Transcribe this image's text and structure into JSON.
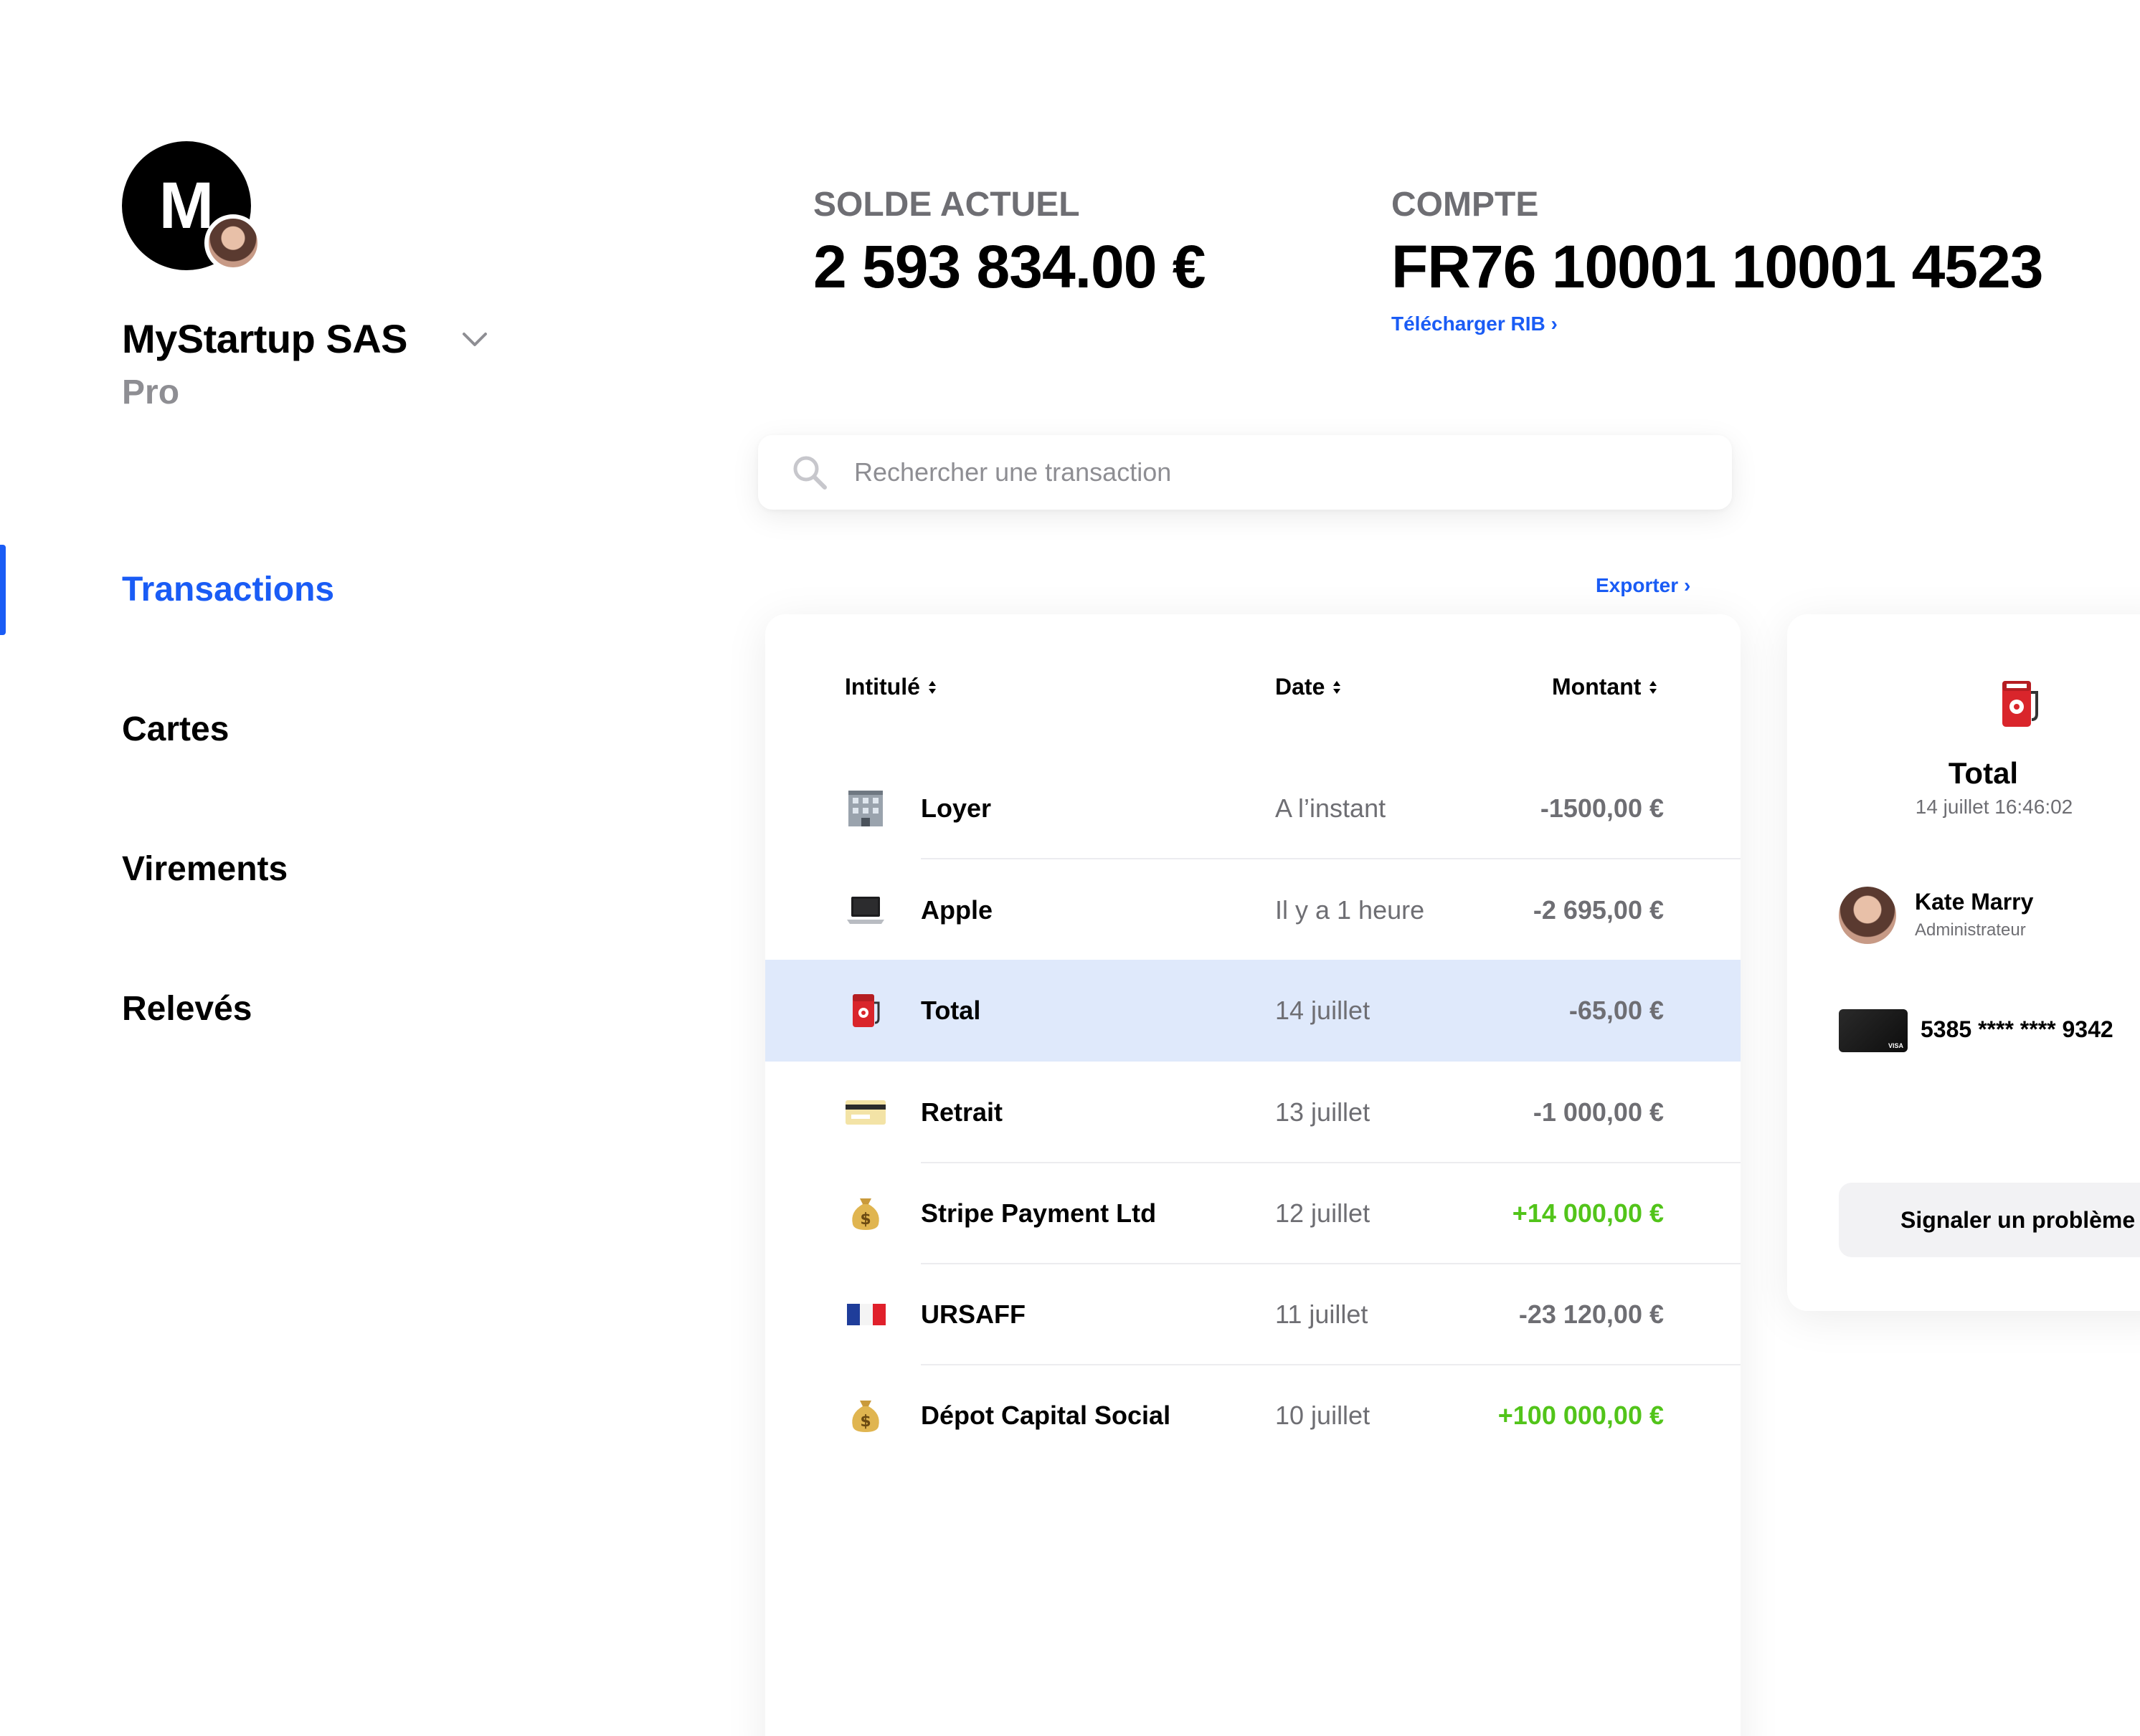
{
  "sidebar": {
    "avatar_letter": "M",
    "company_name": "MyStartup SAS",
    "plan": "Pro",
    "nav": [
      {
        "label": "Transactions",
        "active": true
      },
      {
        "label": "Cartes",
        "active": false
      },
      {
        "label": "Virements",
        "active": false
      },
      {
        "label": "Relevés",
        "active": false
      }
    ]
  },
  "header": {
    "balance_label": "SOLDE ACTUEL",
    "balance_value": "2 593 834.00 €",
    "account_label": "COMPTE",
    "account_value": "FR76 10001 10001 4523",
    "rib_link": "Télécharger RIB"
  },
  "search": {
    "placeholder": "Rechercher une transaction",
    "value": ""
  },
  "export_link": "Exporter",
  "table": {
    "columns": [
      "Intitulé",
      "Date",
      "Montant"
    ],
    "rows": [
      {
        "icon": "office-building-icon",
        "label": "Loyer",
        "date": "A l’instant",
        "amount": "-1500,00 €",
        "positive": false,
        "selected": false
      },
      {
        "icon": "laptop-icon",
        "label": "Apple",
        "date": "Il y a 1 heure",
        "amount": "-2 695,00 €",
        "positive": false,
        "selected": false
      },
      {
        "icon": "fuel-pump-icon",
        "label": "Total",
        "date": "14 juillet",
        "amount": "-65,00 €",
        "positive": false,
        "selected": true
      },
      {
        "icon": "credit-card-icon",
        "label": "Retrait",
        "date": "13 juillet",
        "amount": "-1 000,00 €",
        "positive": false,
        "selected": false
      },
      {
        "icon": "money-bag-icon",
        "label": "Stripe Payment Ltd",
        "date": "12 juillet",
        "amount": "+14 000,00 €",
        "positive": true,
        "selected": false
      },
      {
        "icon": "french-flag-icon",
        "label": "URSAFF",
        "date": "11 juillet",
        "amount": "-23 120,00 €",
        "positive": false,
        "selected": false
      },
      {
        "icon": "money-bag-icon",
        "label": "Dépot Capital Social",
        "date": "10 juillet",
        "amount": "+100 000,00 €",
        "positive": true,
        "selected": false
      }
    ]
  },
  "detail": {
    "icon": "fuel-pump-icon",
    "title": "Total",
    "datetime": "14 juillet 16:46:02",
    "user_name": "Kate Marry",
    "user_role": "Administrateur",
    "card_number": "5385 **** **** 9342",
    "card_brand": "VISA",
    "report_button": "Signaler un problème ?"
  },
  "colors": {
    "accent": "#1a5cf5",
    "positive": "#52c41a",
    "muted": "#6e6e73",
    "selected_row": "#dfe9fb"
  }
}
